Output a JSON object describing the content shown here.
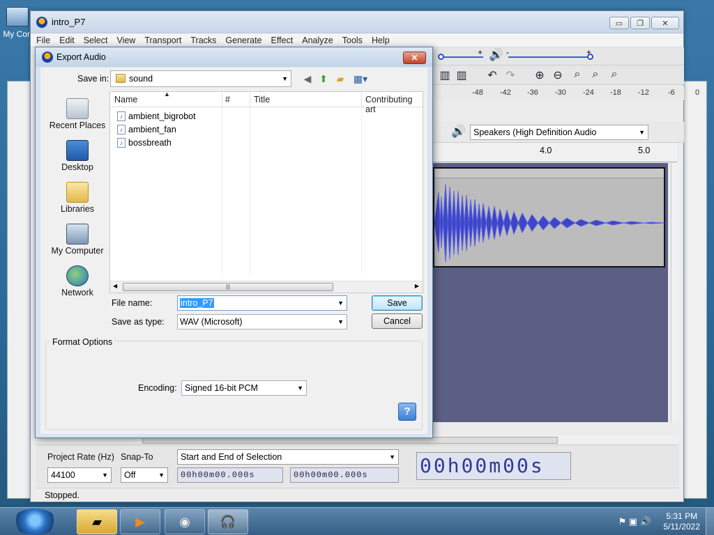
{
  "desktop": {
    "icon_label": "My Con"
  },
  "main_window": {
    "title": "intro_P7",
    "window_controls": {
      "minimize": "▭",
      "maximize": "❐",
      "close": "✕"
    },
    "menu": [
      "File",
      "Edit",
      "Select",
      "View",
      "Transport",
      "Tracks",
      "Generate",
      "Effect",
      "Analyze",
      "Tools",
      "Help"
    ],
    "meter_ticks": [
      "-48",
      "-42",
      "-36",
      "-30",
      "-24",
      "-18",
      "-12",
      "-6",
      "0"
    ],
    "playback_device": "Speakers (High Definition Audio",
    "timeline_ticks": [
      "4.0",
      "5.0"
    ],
    "selection_toolbar": {
      "project_rate_label": "Project Rate (Hz)",
      "project_rate_value": "44100",
      "snap_to_label": "Snap-To",
      "snap_to_value": "Off",
      "selection_mode": "Start and End of Selection",
      "start_time": "00h00m00.000s",
      "end_time": "00h00m00.000s",
      "big_time": "00h00m00s"
    },
    "status": "Stopped."
  },
  "dialog": {
    "title": "Export Audio",
    "close": "✕",
    "save_in_label": "Save in:",
    "save_in_value": "sound",
    "places": [
      "Recent Places",
      "Desktop",
      "Libraries",
      "My Computer",
      "Network"
    ],
    "columns": {
      "name": "Name",
      "number": "#",
      "title": "Title",
      "artist": "Contributing art"
    },
    "files": [
      "ambient_bigrobot",
      "ambient_fan",
      "bossbreath"
    ],
    "file_name_label": "File name:",
    "file_name_value": "intro_P7",
    "save_as_type_label": "Save as type:",
    "save_as_type_value": "WAV (Microsoft)",
    "save_button": "Save",
    "cancel_button": "Cancel",
    "format_options_label": "Format Options",
    "encoding_label": "Encoding:",
    "encoding_value": "Signed 16-bit PCM",
    "help_button": "?"
  },
  "taskbar": {
    "time": "5:31 PM",
    "date": "5/11/2022"
  }
}
